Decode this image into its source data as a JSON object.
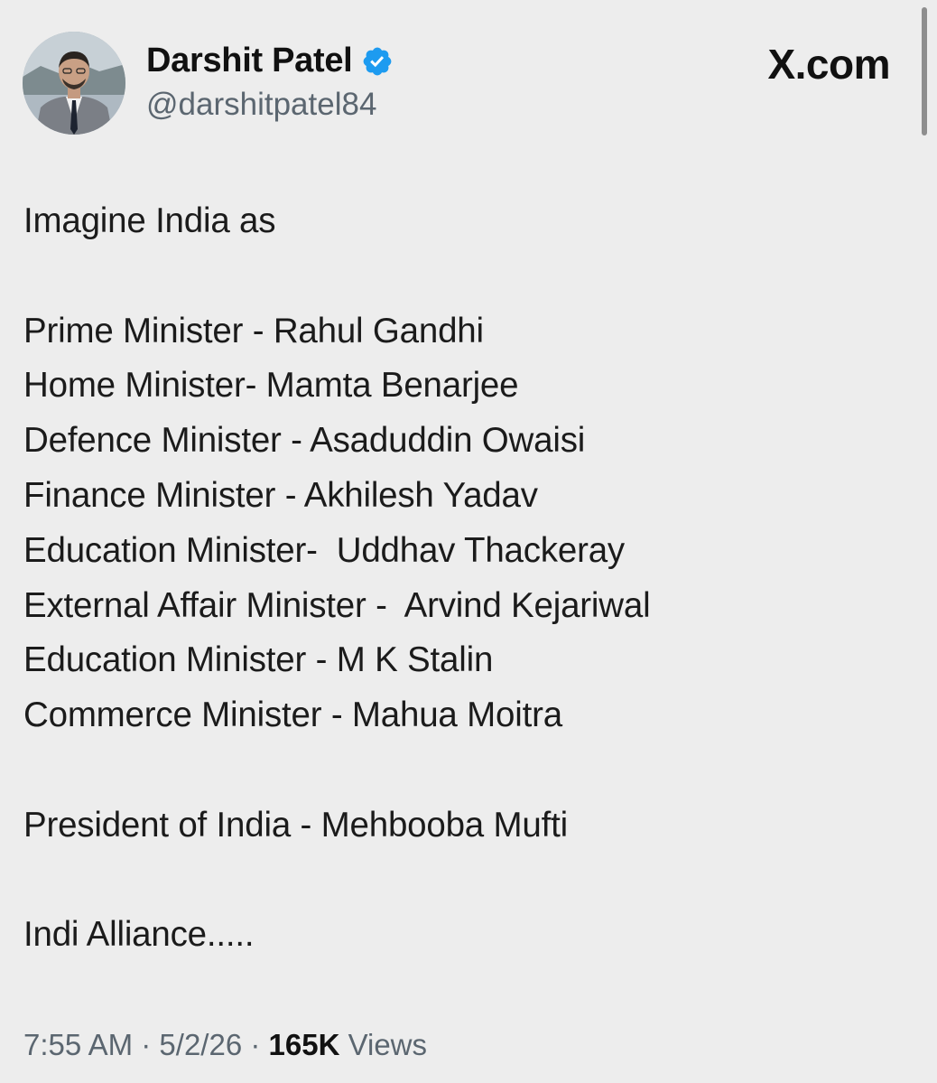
{
  "author": {
    "name": "Darshit Patel",
    "handle": "@darshitpatel84",
    "avatar_icon": "profile-photo",
    "verified_icon": "verified-badge-icon",
    "verified_color": "#1d9bf0"
  },
  "source": {
    "label": "X.com"
  },
  "tweet": {
    "lines": [
      "Imagine India as",
      "",
      "Prime Minister - Rahul Gandhi",
      "Home Minister- Mamta Benarjee",
      "Defence Minister - Asaduddin Owaisi",
      "Finance Minister - Akhilesh Yadav",
      "Education Minister-  Uddhav Thackeray",
      "External Affair Minister -  Arvind Kejariwal",
      "Education Minister - M K Stalin",
      "Commerce Minister - Mahua Moitra",
      "",
      "President of India - Mehbooba Mufti",
      "",
      "Indi Alliance....."
    ]
  },
  "meta": {
    "time": "7:55 AM",
    "separator": "·",
    "date": "5/2/26",
    "views_count": "165K",
    "views_label": "Views"
  },
  "colors": {
    "background": "#ededed",
    "text": "#1b1b1b",
    "muted": "#5b6670"
  }
}
